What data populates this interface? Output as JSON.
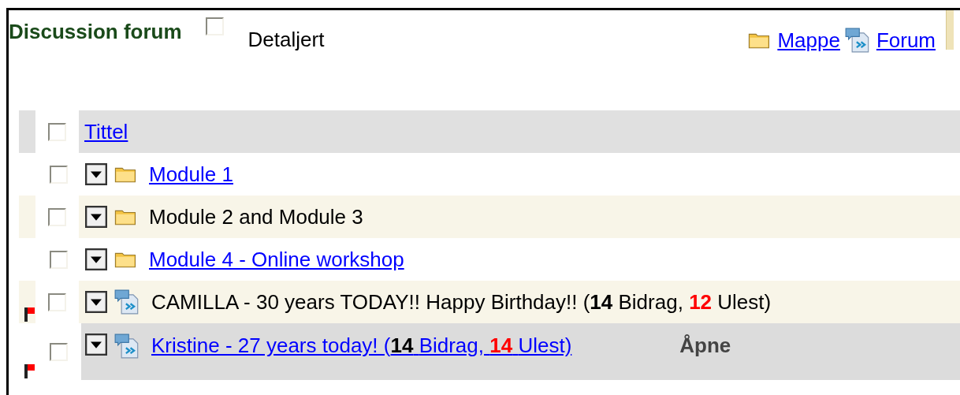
{
  "header": {
    "title": "Discussion forum",
    "detail_toggle": {
      "label": "Detaljert",
      "checked": false
    },
    "links": [
      {
        "kind": "folder",
        "label": "Mappe"
      },
      {
        "kind": "forum",
        "label": "Forum"
      }
    ]
  },
  "table": {
    "header": {
      "checked": false,
      "label": "Tittel"
    },
    "rows": [
      {
        "kind": "folder",
        "checked": false,
        "flagged": false,
        "shaded": false,
        "selected": false,
        "linked": true,
        "title": "Module 1"
      },
      {
        "kind": "folder",
        "checked": false,
        "flagged": false,
        "shaded": true,
        "selected": false,
        "linked": false,
        "title": "Module 2 and Module 3"
      },
      {
        "kind": "folder",
        "checked": false,
        "flagged": false,
        "shaded": false,
        "selected": false,
        "linked": true,
        "title": "Module 4 - Online workshop"
      },
      {
        "kind": "forum",
        "checked": false,
        "flagged": true,
        "shaded": true,
        "selected": false,
        "linked": false,
        "title": "CAMILLA - 30 years TODAY!! Happy Birthday!! (",
        "posts": "14",
        "posts_label": "Bidrag,",
        "unread": "12",
        "unread_label": "Ulest)"
      },
      {
        "kind": "forum",
        "checked": false,
        "flagged": true,
        "shaded": false,
        "selected": true,
        "linked": true,
        "title": "Kristine - 27 years today! (",
        "posts": "14",
        "posts_label": "Bidrag,",
        "unread": "14",
        "unread_label": "Ulest)",
        "action": "Åpne"
      }
    ]
  }
}
